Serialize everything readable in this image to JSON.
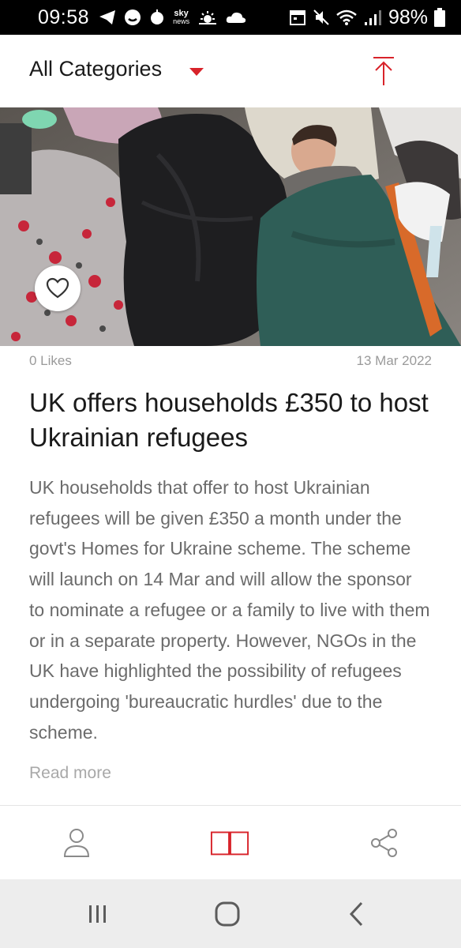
{
  "status_bar": {
    "time": "09:58",
    "sky_news_top": "sky",
    "sky_news_bottom": "news",
    "battery": "98%",
    "icons": [
      "telegram-icon",
      "messenger-icon",
      "dollar-icon",
      "sky-news-icon",
      "weather-icon",
      "cloud-icon",
      "calendar-icon",
      "mute-icon",
      "wifi-icon",
      "signal-icon",
      "battery-icon"
    ]
  },
  "header": {
    "category": "All Categories",
    "accent_color": "#d8232a"
  },
  "article": {
    "likes": "0 Likes",
    "date": "13 Mar 2022",
    "title": "UK offers households £350 to host Ukrainian refugees",
    "summary": "UK households that offer to host Ukrainian refugees will be given £350 a month under the govt's Homes for Ukraine scheme. The scheme will launch on 14 Mar and will allow the sponsor to nominate a refugee or a family to live with them or in a separate property. However, NGOs in the UK have highlighted the possibility of refugees undergoing 'bureaucratic hurdles' due to the scheme.",
    "read_more": "Read more"
  },
  "tabs": [
    {
      "name": "profile-icon"
    },
    {
      "name": "book-icon",
      "active": true
    },
    {
      "name": "share-icon"
    }
  ],
  "nav": [
    "recents-icon",
    "home-icon",
    "back-icon"
  ]
}
